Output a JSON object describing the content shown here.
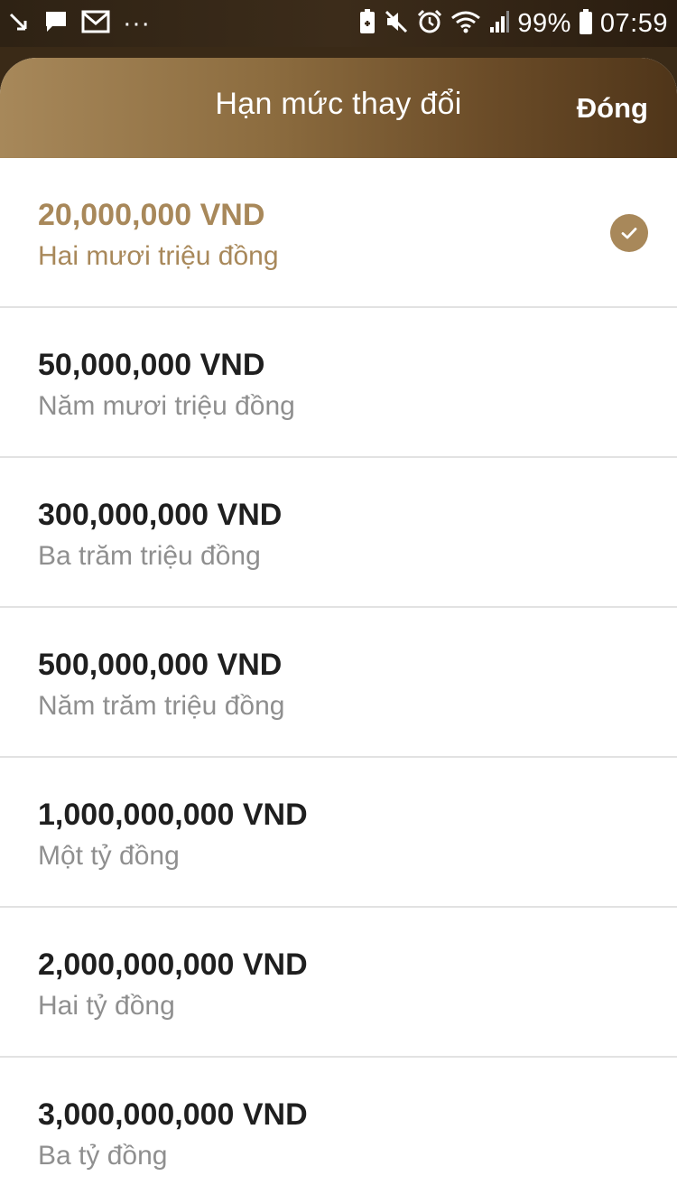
{
  "status_bar": {
    "battery": "99%",
    "time": "07:59",
    "overflow": "···",
    "left_icons": [
      "missed-call-icon",
      "chat-bubble-icon",
      "gmail-icon"
    ],
    "right_icons": [
      "battery-saver-icon",
      "mute-icon",
      "alarm-icon",
      "wifi-icon",
      "signal-icon",
      "battery-icon"
    ]
  },
  "header": {
    "title": "Hạn mức thay đổi",
    "close_label": "Đóng"
  },
  "colors": {
    "accent": "#a8885a",
    "header_gradient_start": "#a7885a",
    "header_gradient_end": "#4f3519",
    "primary_text": "#1f1f1f",
    "secondary_text": "#8f8f8f",
    "divider": "#e2e2e2"
  },
  "limits": [
    {
      "amount": "20,000,000 VND",
      "words": "Hai mươi triệu đồng",
      "selected": true
    },
    {
      "amount": "50,000,000 VND",
      "words": "Năm mươi triệu đồng",
      "selected": false
    },
    {
      "amount": "300,000,000 VND",
      "words": "Ba trăm triệu đồng",
      "selected": false
    },
    {
      "amount": "500,000,000 VND",
      "words": "Năm trăm triệu đồng",
      "selected": false
    },
    {
      "amount": "1,000,000,000 VND",
      "words": "Một tỷ đồng",
      "selected": false
    },
    {
      "amount": "2,000,000,000 VND",
      "words": "Hai tỷ đồng",
      "selected": false
    },
    {
      "amount": "3,000,000,000 VND",
      "words": "Ba tỷ đồng",
      "selected": false
    }
  ]
}
